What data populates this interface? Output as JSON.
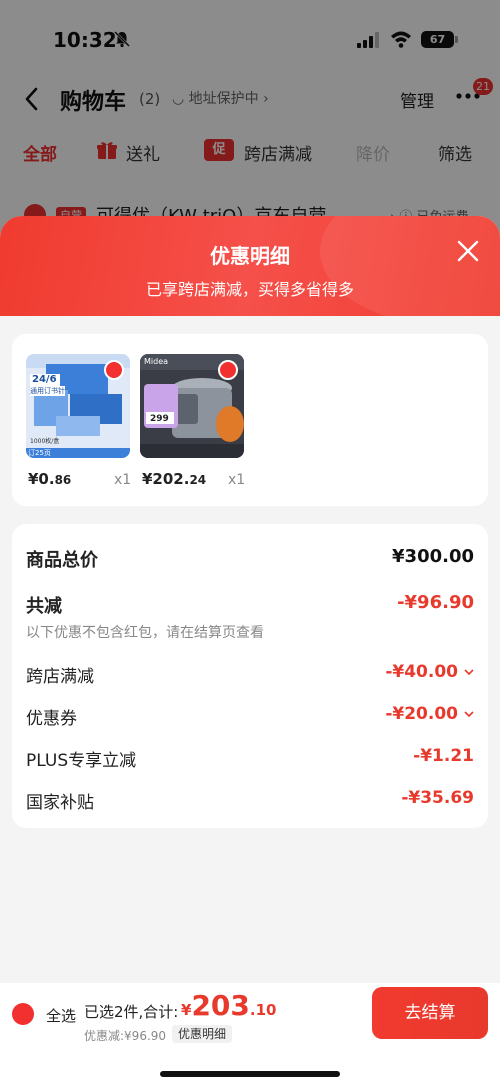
{
  "status_bar": {
    "time": "10:32",
    "battery": "67"
  },
  "nav": {
    "title": "购物车",
    "count": "(2)",
    "address_protect": "地址保护中 ›",
    "manage": "管理",
    "more_badge": "21"
  },
  "filter_tabs": {
    "all": "全部",
    "gift": "送礼",
    "promo_tag": "促",
    "cross_store": "跨店满减",
    "price_drop": "降价",
    "filter": "筛选"
  },
  "shop": {
    "tag": "自营",
    "name": "可得优（KW-triO）京东自营",
    "shipping": "› ⓘ 已免运费"
  },
  "sheet": {
    "title": "优惠明细",
    "subtitle": "已享跨店满减，买得多省得多"
  },
  "products": [
    {
      "image_text_top": "24/6",
      "image_text_sub": "通用订书针",
      "image_text_count": "1000枚/盒",
      "image_text_badge": "订25页",
      "price_int": "¥0.",
      "price_dec": "86",
      "qty": "x1"
    },
    {
      "image_brand": "Midea",
      "image_price": "299",
      "price_int": "¥202.",
      "price_dec": "24",
      "qty": "x1"
    }
  ],
  "details": {
    "total_label": "商品总价",
    "total_value": "¥300.00",
    "reduce_label": "共减",
    "reduce_value": "-¥96.90",
    "note": "以下优惠不包含红包，请在结算页查看",
    "items": [
      {
        "label": "跨店满减",
        "value": "-¥40.00"
      },
      {
        "label": "优惠券",
        "value": "-¥20.00"
      },
      {
        "label": "PLUS专享立减",
        "value": "-¥1.21"
      },
      {
        "label": "国家补贴",
        "value": "-¥35.69"
      }
    ]
  },
  "bottom": {
    "select_all": "全选",
    "summary": "已选2件,合计:",
    "total_currency": "¥",
    "total_int": "203",
    "total_dec": ".10",
    "discount": "优惠减:¥96.90",
    "detail_link": "优惠明细",
    "checkout": "去结算"
  },
  "colors": {
    "accent": "#f23030",
    "price_red": "#e8392d"
  }
}
